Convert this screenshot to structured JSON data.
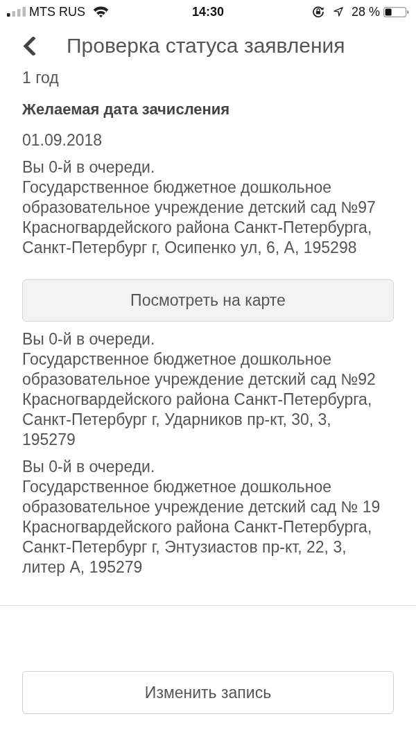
{
  "status_bar": {
    "carrier": "MTS RUS",
    "time": "14:30",
    "battery_percent": "28 %"
  },
  "header": {
    "title": "Проверка статуса заявления"
  },
  "fields": [
    {
      "kind": "value",
      "text": "1 год"
    },
    {
      "kind": "label",
      "text": "Желаемая дата зачисления"
    },
    {
      "kind": "value",
      "text": "01.09.2018"
    }
  ],
  "kindergartens": [
    {
      "queue": "Вы 0-й в очереди.",
      "address": "Государственное бюджетное дошкольное образовательное учреждение детский сад №97 Красногвардейского района Санкт-Петербурга, Санкт-Петербург г, Осипенко ул, 6, А, 195298",
      "map_button": "Посмотреть на карте"
    },
    {
      "queue": "Вы 0-й в очереди.",
      "address": "Государственное бюджетное дошкольное образовательное учреждение детский сад №92 Красногвардейского района Санкт-Петербурга, Санкт-Петербург г, Ударников пр-кт, 30, 3, 195279"
    },
    {
      "queue": "Вы 0-й в очереди.",
      "address": "Государственное бюджетное дошкольное образовательное учреждение детский сад № 19 Красногвардейского района Санкт-Петербурга, Санкт-Петербург г, Энтузиастов пр-кт, 22, 3, литер А, 195279"
    }
  ],
  "footer": {
    "edit_button": "Изменить запись"
  }
}
